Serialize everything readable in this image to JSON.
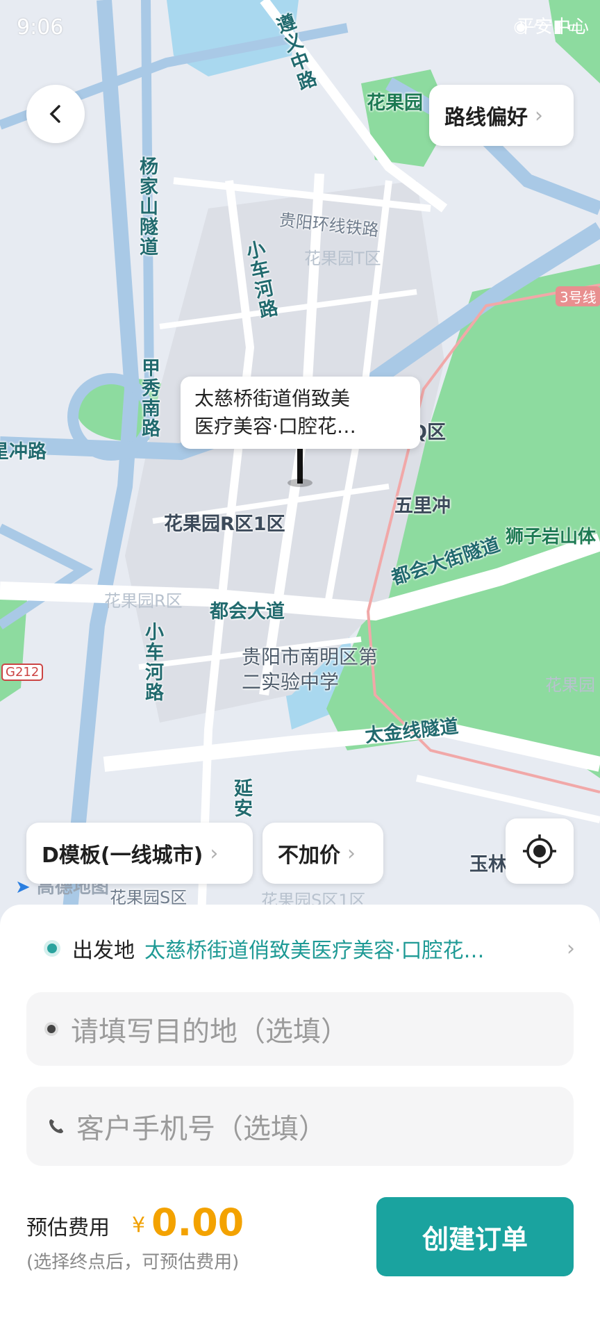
{
  "status_bar": {
    "time": "9:06"
  },
  "map": {
    "labels": {
      "zunyi_road": "遵义中路",
      "huaguoyuan": "花果园",
      "yangjiashan_tunnel": "杨家山隧道",
      "guiyang_ring_rail": "贵阳环线铁路",
      "huaguoyuan_t": "花果园T区",
      "xiaochehe_road_1": "小车河路",
      "line3": "3号线",
      "jiaxiu_south_road": "甲秀南路",
      "chong_road": "星冲路",
      "q_zone": "Q区",
      "wulichong": "五里冲",
      "huaguoyuan_r1": "花果园R区1区",
      "shiziyan": "狮子岩山体",
      "huaguoyuan_r": "花果园R区",
      "duhui_avenue": "都会大道",
      "duhui_tunnel": "都会大街隧道",
      "xiaochehe_road_2": "小车河路",
      "g212": "G212",
      "school": "贵阳市南明区第二实验中学",
      "huaguoyuan_right": "花果园",
      "taijin_tunnel": "太金线隧道",
      "yanan": "延安",
      "yu": "玉林",
      "huaguoyuan_s": "花果园S区",
      "huaguoyuan_s1": "花果园S区1区",
      "top_right": "平安中心"
    },
    "logo": "高德地图",
    "callout_line1": "太慈桥街道俏致美",
    "callout_line2": "医疗美容·口腔花…"
  },
  "controls": {
    "route_pref": "路线偏好",
    "template": "D模板(一线城市)",
    "price": "不加价"
  },
  "form": {
    "origin_label": "出发地",
    "origin_value": "太慈桥街道俏致美医疗美容·口腔花…",
    "destination_placeholder": "请填写目的地（选填）",
    "phone_placeholder": "客户手机号（选填）"
  },
  "fee": {
    "label": "预估费用",
    "currency": "¥",
    "amount": "0.00",
    "note": "(选择终点后，可预估费用)"
  },
  "actions": {
    "create_order": "创建订单"
  },
  "colors": {
    "accent": "#1aa39f",
    "price": "#f3a200",
    "park": "#8ddb9f"
  }
}
